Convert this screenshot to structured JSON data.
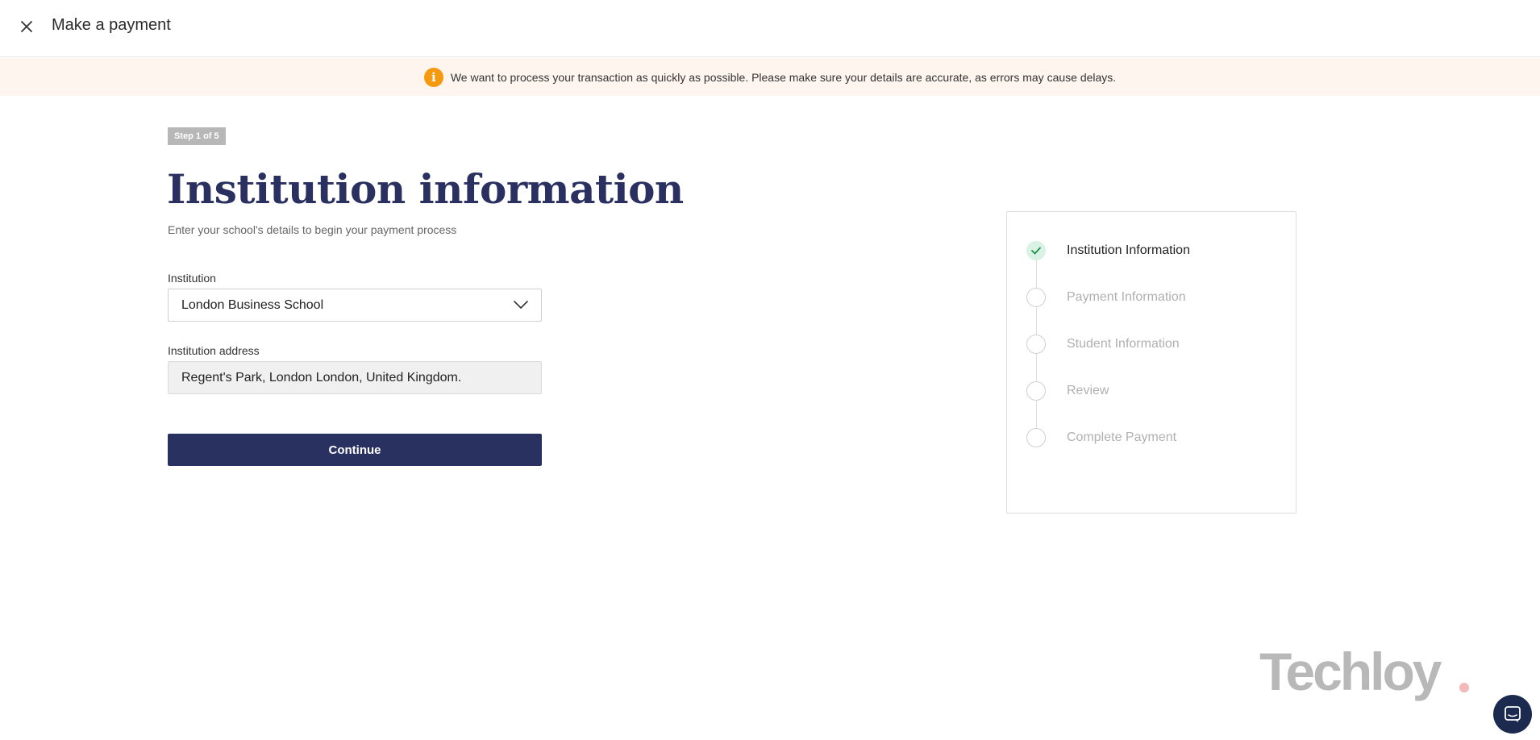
{
  "header": {
    "title": "Make a payment",
    "close_icon": "close-icon"
  },
  "banner": {
    "icon": "info-icon",
    "icon_glyph": "i",
    "text": "We want to process your transaction as quickly as possible. Please make sure your details are accurate, as errors may cause delays.",
    "color": "#f59a10",
    "background": "#fef6ee"
  },
  "form": {
    "step_badge": "Step 1 of 5",
    "heading": "Institution information",
    "subheading": "Enter your school's details to begin your payment process",
    "institution": {
      "label": "Institution",
      "value": "London Business School"
    },
    "address": {
      "label": "Institution address",
      "value": "Regent's Park, London London, United Kingdom."
    },
    "continue_label": "Continue",
    "accent": "#293160"
  },
  "steps": [
    {
      "label": "Institution Information",
      "status": "complete"
    },
    {
      "label": "Payment Information",
      "status": "pending"
    },
    {
      "label": "Student Information",
      "status": "pending"
    },
    {
      "label": "Review",
      "status": "pending"
    },
    {
      "label": "Complete Payment",
      "status": "pending"
    }
  ],
  "watermark": {
    "text": "Techloy"
  },
  "chat": {
    "icon": "chat-icon"
  }
}
